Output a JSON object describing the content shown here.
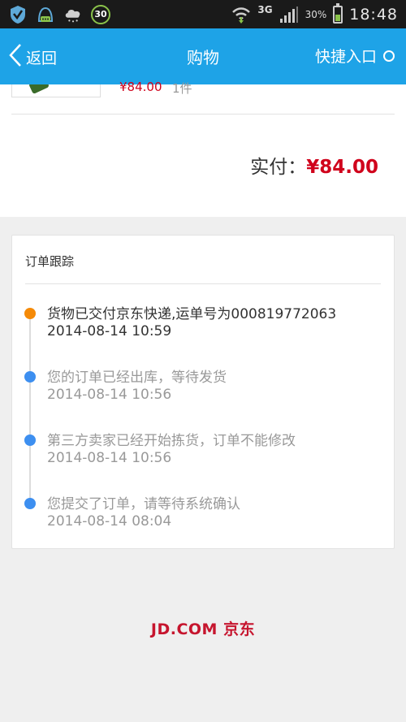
{
  "status_bar": {
    "battery_pct": "30%",
    "network": "3G",
    "time": "18:48",
    "badge": "30",
    "battery_level": 0.3
  },
  "header": {
    "back_label": "返回",
    "title": "购物",
    "quick_label": "快捷入口"
  },
  "product": {
    "price": "¥84.00",
    "qty": "1件"
  },
  "payment": {
    "label": "实付：",
    "amount": "¥84.00"
  },
  "tracking": {
    "title": "订单跟踪",
    "events": [
      {
        "msg": "货物已交付京东快递,运单号为000819772063",
        "time": "2014-08-14 10:59"
      },
      {
        "msg": "您的订单已经出库，等待发货",
        "time": "2014-08-14 10:56"
      },
      {
        "msg": "第三方卖家已经开始拣货，订单不能修改",
        "time": "2014-08-14 10:56"
      },
      {
        "msg": "您提交了订单，请等待系统确认",
        "time": "2014-08-14 08:04"
      }
    ]
  },
  "footer": {
    "logo_text": "JD.COM 京东"
  },
  "colors": {
    "header_bg": "#1ea3e7",
    "price_red": "#d0021b",
    "dot_orange": "#f58a07",
    "dot_blue": "#3d8ff0"
  }
}
